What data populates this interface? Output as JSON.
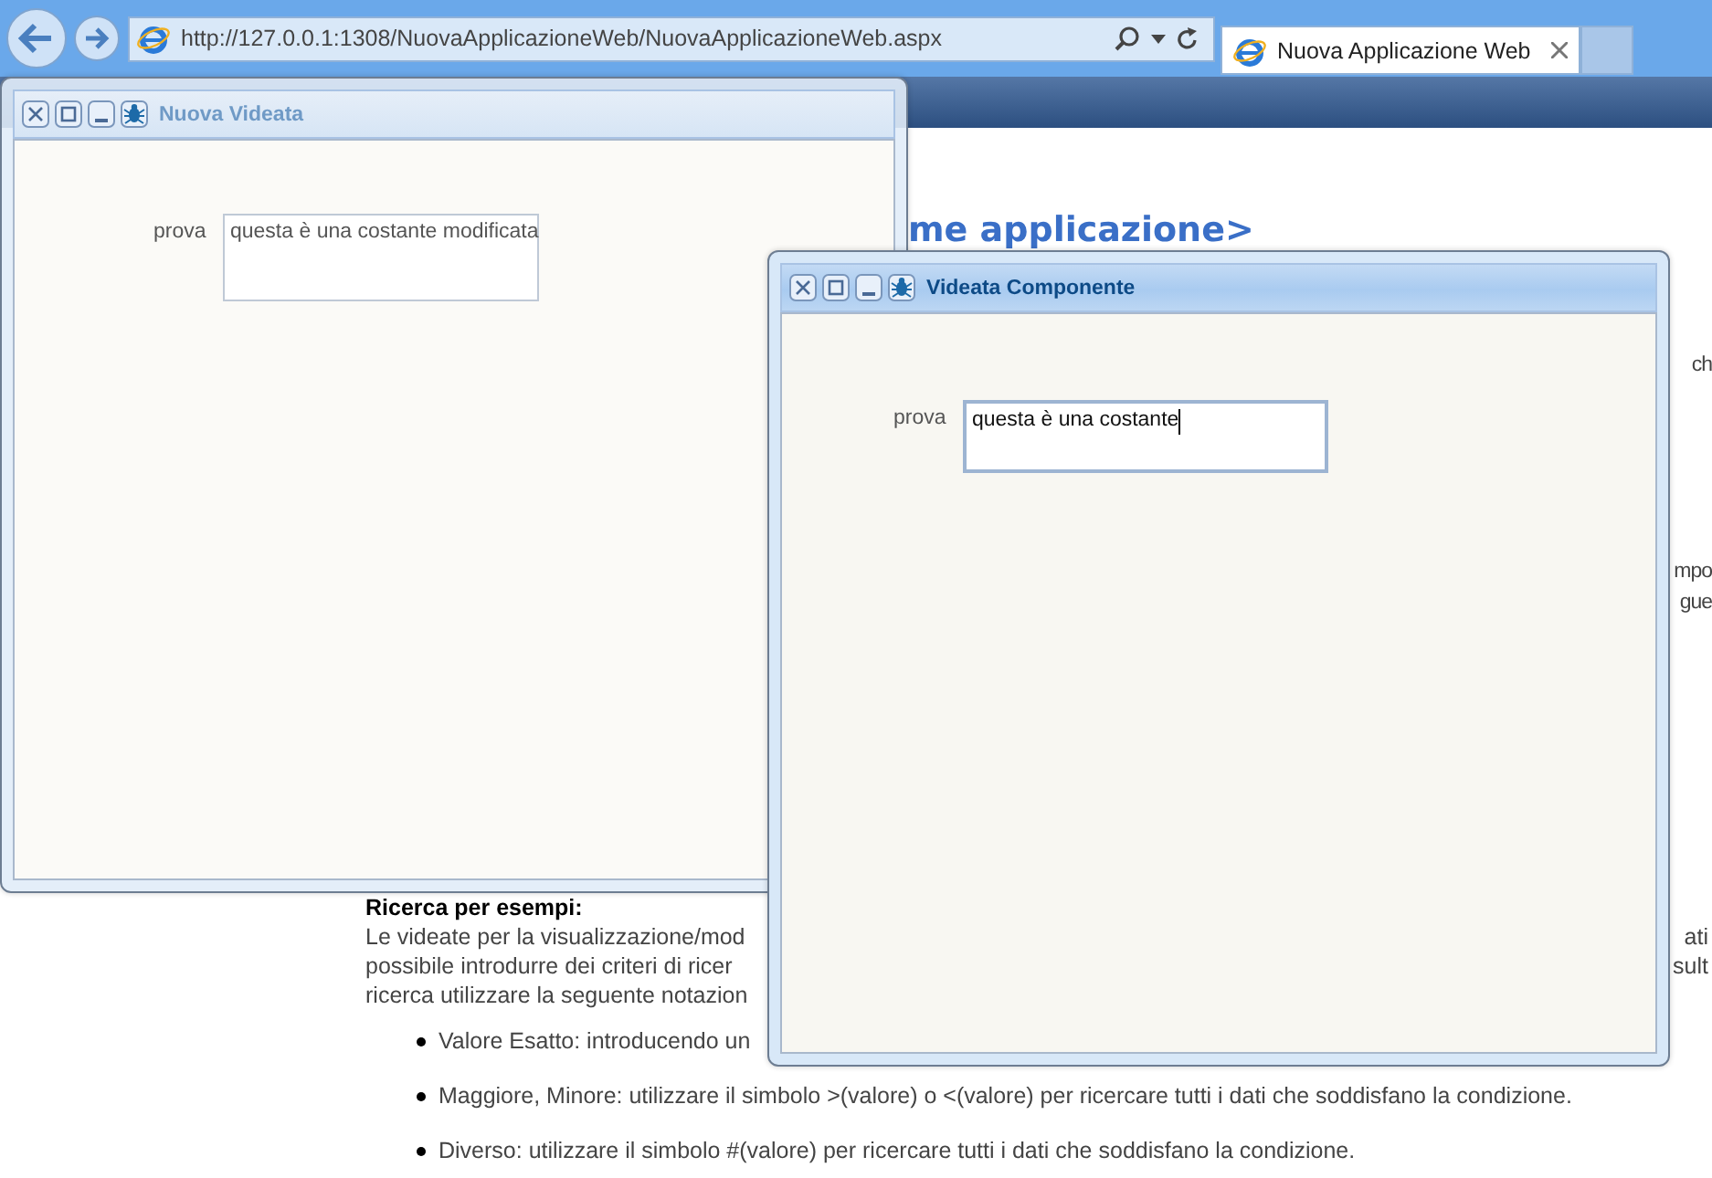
{
  "browser": {
    "address": "http://127.0.0.1:1308/NuovaApplicazioneWeb/NuovaApplicazioneWeb.aspx",
    "tab": {
      "label": "Nuova Applicazione Web",
      "selected": true
    }
  },
  "page": {
    "heading": "me applicazione>",
    "right_fragments": [
      "ch",
      "mpo",
      "gue"
    ],
    "section_title": "Ricerca per esempi:",
    "paragraph_lines": [
      {
        "left": "Le videate per la visualizzazione/mod",
        "right": "ati"
      },
      {
        "left": "possibile introdurre dei criteri di ricer",
        "right": "sult"
      },
      {
        "left": "ricerca utilizzare la seguente notazion"
      }
    ],
    "bullets": [
      "Valore Esatto: introducendo un",
      "Maggiore, Minore: utilizzare il simbolo >(valore) o <(valore) per ricercare tutti i dati che soddisfano la condizione.",
      "Diverso: utilizzare il simbolo #(valore)  per ricercare tutti i dati che soddisfano la condizione."
    ]
  },
  "windows": [
    {
      "title": "Nuova Videata",
      "active": false,
      "field": {
        "label": "prova",
        "value": "questa è una costante modificata"
      }
    },
    {
      "title": "Videata Componente",
      "active": true,
      "field": {
        "label": "prova",
        "value": "questa è una costante"
      }
    }
  ]
}
